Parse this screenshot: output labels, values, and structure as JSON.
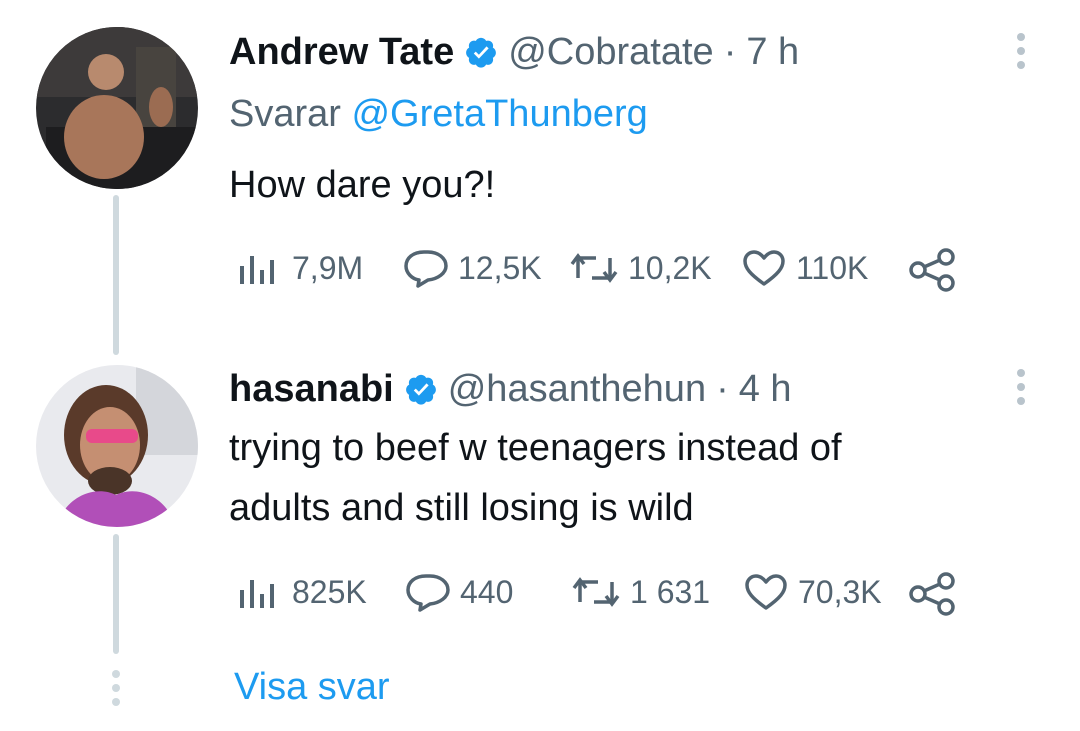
{
  "tweets": [
    {
      "author_name": "Andrew Tate",
      "handle": "@Cobratate",
      "separator": "·",
      "time": "7 h",
      "reply_prefix": "Svarar",
      "reply_to": "@GretaThunberg",
      "text": "How dare you?!",
      "views": "7,9M",
      "replies": "12,5K",
      "retweets": "10,2K",
      "likes": "110K"
    },
    {
      "author_name": "hasanabi",
      "handle": "@hasanthehun",
      "separator": "·",
      "time": "4 h",
      "text_line1": "trying to beef w teenagers instead of",
      "text_line2": "adults and still losing is wild",
      "views": "825K",
      "replies": "440",
      "retweets": "1 631",
      "likes": "70,3K"
    }
  ],
  "show_replies_label": "Visa svar",
  "colors": {
    "accent": "#1d9bf0",
    "secondary_text": "#536471",
    "thread_line": "#cfd9de"
  }
}
